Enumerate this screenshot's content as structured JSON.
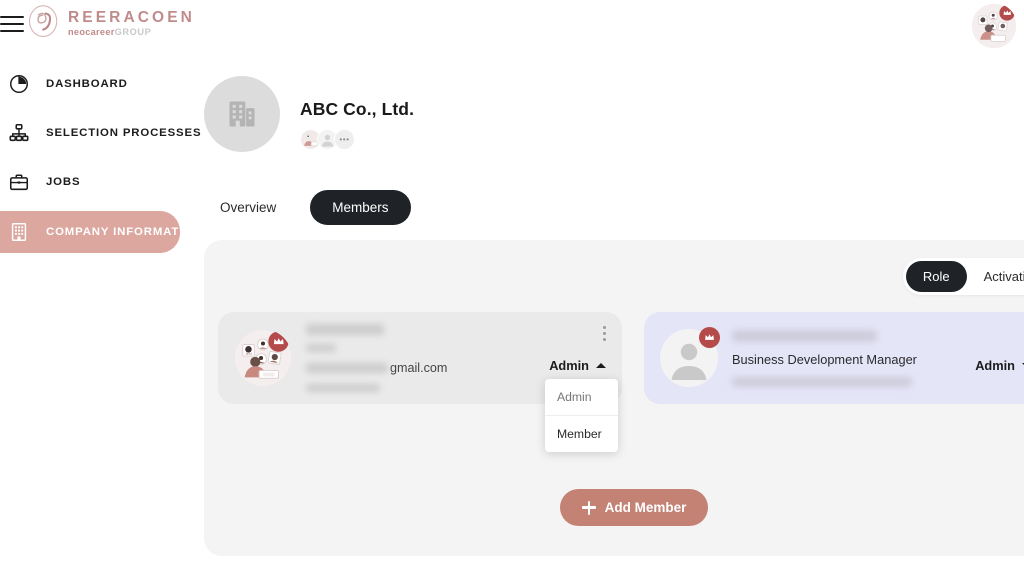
{
  "brand": {
    "name": "REERACOEN",
    "sub_primary": "neocareer",
    "sub_secondary": "GROUP",
    "logo_icon": "reeracoen-monogram-icon",
    "menu_icon": "hamburger-menu-icon",
    "user_avatar_icon": "user-avatar-illustration"
  },
  "sidebar": {
    "items": [
      {
        "label": "DASHBOARD",
        "icon": "pie-chart-icon",
        "active": false
      },
      {
        "label": "SELECTION PROCESSES",
        "icon": "org-chart-icon",
        "active": false
      },
      {
        "label": "JOBS",
        "icon": "briefcase-icon",
        "active": false
      },
      {
        "label": "COMPANY INFORMATION",
        "icon": "building-grid-icon",
        "active": true
      }
    ]
  },
  "company": {
    "name": "ABC Co., Ltd.",
    "logo_icon": "office-building-icon",
    "chips": [
      {
        "icon": "team-illustration-avatar"
      },
      {
        "icon": "person-avatar-icon"
      },
      {
        "label": "•••",
        "icon": "more-members-icon"
      }
    ]
  },
  "tabs": [
    {
      "label": "Overview",
      "active": false
    },
    {
      "label": "Members",
      "active": true
    }
  ],
  "panel": {
    "segments": [
      {
        "label": "Role",
        "active": true
      },
      {
        "label": "Activation",
        "active": false
      }
    ],
    "members": [
      {
        "avatar_icon": "team-illustration-avatar",
        "badge_icon": "crown-icon",
        "name_redacted": true,
        "title_redacted": true,
        "email_visible_tail": "gmail.com",
        "role": "Admin",
        "role_caret": "caret-up",
        "menu_icon": "kebab-menu-icon",
        "highlighted": false
      },
      {
        "avatar_icon": "person-avatar-icon",
        "badge_icon": "crown-icon",
        "name_redacted": true,
        "title": "Business Development Manager",
        "email_redacted": true,
        "role": "Admin",
        "role_caret": "caret-down",
        "menu_icon": "kebab-menu-icon",
        "highlighted": true
      }
    ],
    "role_dropdown": {
      "open": true,
      "selected": "Admin",
      "options": [
        {
          "label": "Admin",
          "selected": true
        },
        {
          "label": "Member",
          "selected": false
        }
      ]
    },
    "add_member": {
      "label": "Add Member",
      "icon": "plus-icon"
    }
  },
  "colors": {
    "brand_rose": "#c08b8b",
    "active_nav": "#dba79f",
    "add_button": "#c48275",
    "dark_pill": "#1f2328",
    "panel_bg": "#f4f4f4",
    "card_gray": "#eaeaea",
    "card_lavender": "#e5e5f8",
    "crown_badge": "#b44a4a"
  }
}
